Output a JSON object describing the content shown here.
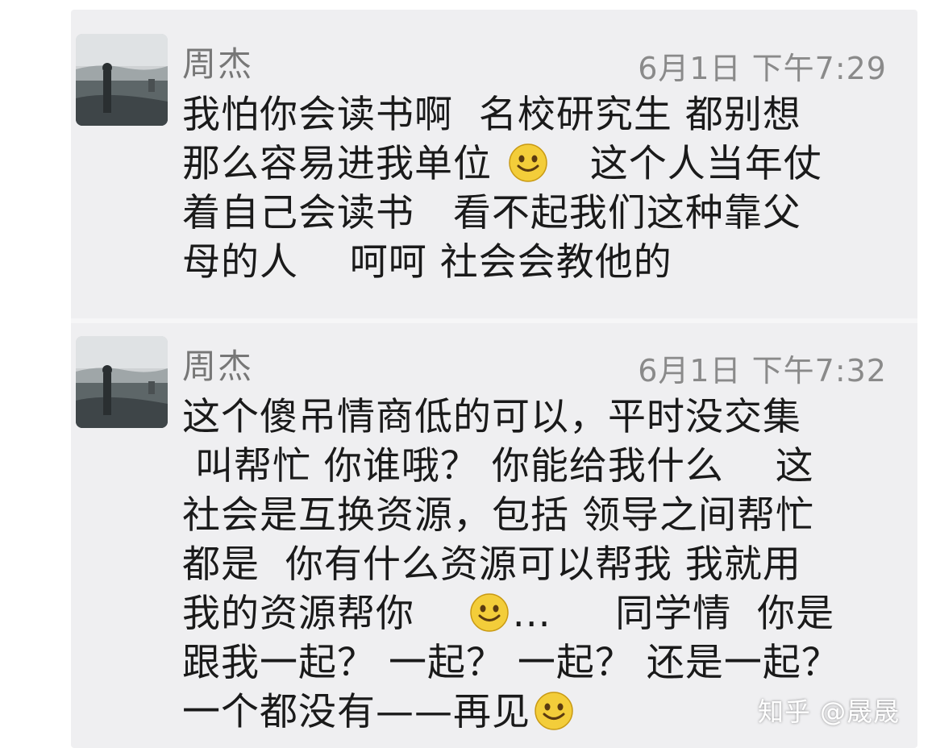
{
  "messages": [
    {
      "sender": "周杰",
      "time": "6月1日 下午7:29",
      "lines": [
        [
          "我怕你会读书啊  名校研究生 都别想"
        ],
        [
          "那么容易进我单位 ",
          "smile-emoji",
          "   这个人当年仗"
        ],
        [
          "着自己会读书   看不起我们这种靠父"
        ],
        [
          "母的人    呵呵 社会会教他的"
        ]
      ]
    },
    {
      "sender": "周杰",
      "time": "6月1日 下午7:32",
      "lines": [
        [
          "这个傻吊情商低的可以，平时没交集"
        ],
        [
          " 叫帮忙 你谁哦？ 你能给我什么    这"
        ],
        [
          "社会是互换资源，包括 领导之间帮忙"
        ],
        [
          "都是  你有什么资源可以帮我 我就用"
        ],
        [
          "我的资源帮你    ",
          "smile-emoji",
          "...     同学情  你是"
        ],
        [
          "跟我一起？ 一起？ 一起？ 还是一起？"
        ],
        [
          "一个都没有——再见",
          "smile-emoji"
        ]
      ]
    }
  ],
  "watermark": "知乎 @晟晟",
  "colors": {
    "panel": "#efeff1",
    "text": "#1a1a1a",
    "meta": "#8a8a8a",
    "emoji": "#f3cd3a"
  }
}
